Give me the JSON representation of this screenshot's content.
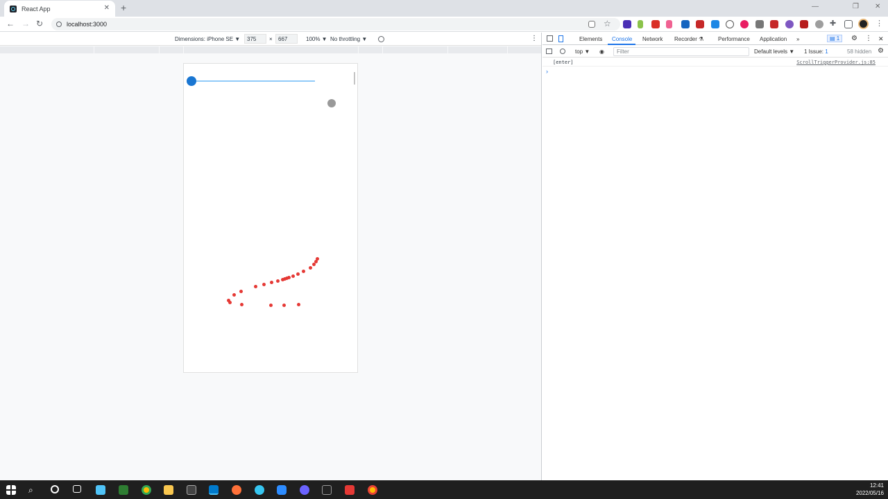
{
  "browser": {
    "tab_title": "React App",
    "tab_close": "✕",
    "new_tab": "+",
    "url": "localhost:3000",
    "window_controls": {
      "minimize": "—",
      "restore": "❐",
      "close": "✕"
    },
    "nav": {
      "back": "←",
      "forward": "→",
      "reload": "↻"
    }
  },
  "device_toolbar": {
    "dimensions_label": "Dimensions: iPhone SE ▼",
    "width": "375",
    "times": "×",
    "height": "667",
    "zoom": "100% ▼",
    "throttling": "No throttling ▼",
    "menu": "⋮"
  },
  "devtools": {
    "tabs": [
      "Elements",
      "Console",
      "Network",
      "Recorder ⚗",
      "Performance",
      "Application",
      "»"
    ],
    "active_tab": "Console",
    "messages_badge": "1",
    "console_bar": {
      "context": "top ▼",
      "filter_placeholder": "Filter",
      "levels": "Default levels ▼",
      "issues": "1 Issue: ",
      "issues_count": "1",
      "hidden": "58 hidden"
    },
    "log": {
      "message": "[enter]",
      "source": "ScrollTriggerProvider.js:85"
    },
    "prompt": "›"
  },
  "taskbar": {
    "time": "12:41",
    "date": "2022/05/16"
  },
  "colors": {
    "slider_thumb": "#1976d2",
    "slider_track": "#90caf9",
    "gray_ball": "#999999",
    "dots": "#e53935",
    "accent": "#1a73e8"
  }
}
